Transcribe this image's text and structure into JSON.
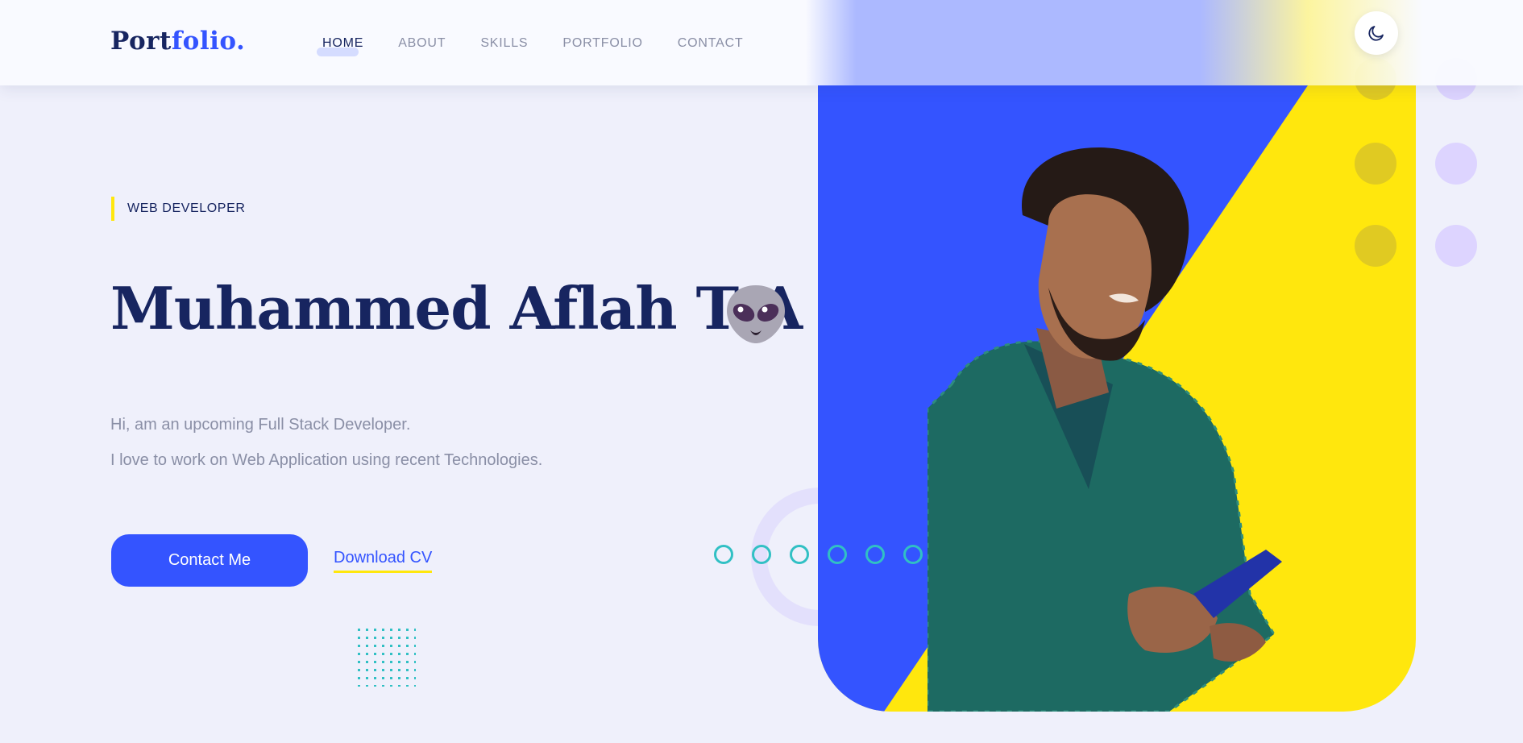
{
  "header": {
    "logo": {
      "part1": "Port",
      "part2": "folio",
      "part3": "."
    },
    "nav": [
      {
        "label": "HOME",
        "active": true
      },
      {
        "label": "ABOUT",
        "active": false
      },
      {
        "label": "SKILLS",
        "active": false
      },
      {
        "label": "PORTFOLIO",
        "active": false
      },
      {
        "label": "CONTACT",
        "active": false
      }
    ],
    "theme_toggle_icon": "moon-icon"
  },
  "hero": {
    "tag": "WEB DEVELOPER",
    "name": "Muhammed Aflah T A",
    "name_emoji_icon": "alien-icon",
    "intro_line1": "Hi, am an upcoming Full Stack Developer.",
    "intro_line2": "I love to work on Web Application using recent Technologies.",
    "contact_button": "Contact Me",
    "download_link": "Download CV",
    "photo_icon": "person-photo"
  },
  "colors": {
    "primary": "#3454ff",
    "accent_yellow": "#ffe70d",
    "navy": "#172560",
    "muted": "#8a8fa6",
    "teal": "#31c0c4",
    "background": "#eff0fb"
  }
}
